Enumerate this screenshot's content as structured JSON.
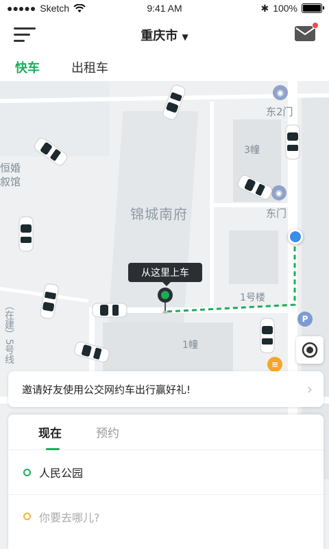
{
  "status_bar": {
    "carrier": "Sketch",
    "time": "9:41 AM",
    "battery": "100%",
    "battery_level": 1.0
  },
  "nav": {
    "city": "重庆市"
  },
  "service_tabs": [
    {
      "label": "快车",
      "active": true
    },
    {
      "label": "出租车",
      "active": false
    }
  ],
  "map": {
    "labels": {
      "east_gate_2": "东2门",
      "building_3": "3幢",
      "east_gate": "东门",
      "compound": "锦城南府",
      "building_no1": "1号楼",
      "building_1": "1幢",
      "left_top": "恒婚",
      "left_mid": "叙馆",
      "left_vertical": "（在建）5号线"
    }
  },
  "pickup": {
    "tip": "从这里上车"
  },
  "banner": {
    "text": "邀请好友使用公交网约车出行赢好礼!"
  },
  "panel": {
    "tabs": [
      {
        "label": "现在"
      },
      {
        "label": "预约"
      }
    ],
    "origin": "人民公园",
    "destination_placeholder": "你要去哪儿?"
  },
  "colors": {
    "accent": "#1aad5a",
    "destination": "#f5b52b",
    "route": "#1aad5a",
    "user_location": "#3b8de8"
  }
}
